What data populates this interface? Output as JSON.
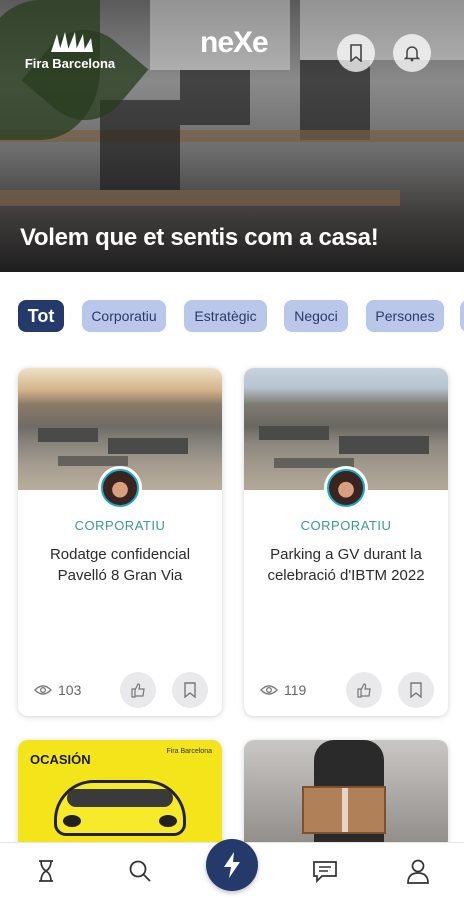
{
  "header": {
    "brand_name": "Fira Barcelona",
    "app_name": "neXe",
    "hero_title": "Volem que et sentis com a casa!"
  },
  "filters": [
    {
      "label": "Tot",
      "active": true
    },
    {
      "label": "Corporatiu",
      "active": false
    },
    {
      "label": "Estratègic",
      "active": false
    },
    {
      "label": "Negoci",
      "active": false
    },
    {
      "label": "Persones",
      "active": false
    }
  ],
  "posts": [
    {
      "category": "CORPORATIU",
      "title": "Rodatge confidencial Pavelló 8 Gran Via",
      "views": "103",
      "image": "aerial-fairground"
    },
    {
      "category": "CORPORATIU",
      "title": "Parking a GV durant la celebració d'IBTM 2022",
      "views": "119",
      "image": "aerial-fairground"
    },
    {
      "category": "",
      "title": "",
      "views": "",
      "image": "yellow-car-poster",
      "poster_text": "OCASIÓN",
      "poster_brand": "Fira Barcelona"
    },
    {
      "category": "",
      "title": "",
      "views": "",
      "image": "gift-box"
    }
  ],
  "nav": {
    "items": [
      "hourglass-icon",
      "search-icon",
      "lightning-icon",
      "chat-icon",
      "profile-icon"
    ]
  },
  "colors": {
    "primary": "#243a6b",
    "chip": "#b9c8ea",
    "category": "#3a9a8e"
  }
}
